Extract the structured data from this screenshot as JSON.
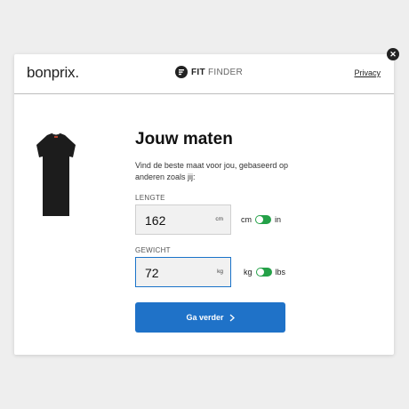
{
  "header": {
    "brand": "bonprix.",
    "fit_finder_bold": "FIT",
    "fit_finder_light": "FINDER",
    "privacy_link": "Privacy"
  },
  "main": {
    "title": "Jouw maten",
    "description": "Vind de beste maat voor jou, gebaseerd op anderen zoals jij:",
    "height": {
      "label": "LENGTE",
      "value": "162",
      "unit": "cm",
      "toggle_left": "cm",
      "toggle_right": "in"
    },
    "weight": {
      "label": "GEWICHT",
      "value": "72",
      "unit": "kg",
      "toggle_left": "kg",
      "toggle_right": "lbs"
    },
    "cta_label": "Ga verder"
  },
  "icons": {
    "close": "close-icon",
    "fit_finder": "fit-finder-logo-icon",
    "cta_arrow": "chevron-right-icon"
  },
  "colors": {
    "primary": "#1f72c8",
    "toggle_on": "#24a148",
    "focus_border": "#1a73c9"
  }
}
